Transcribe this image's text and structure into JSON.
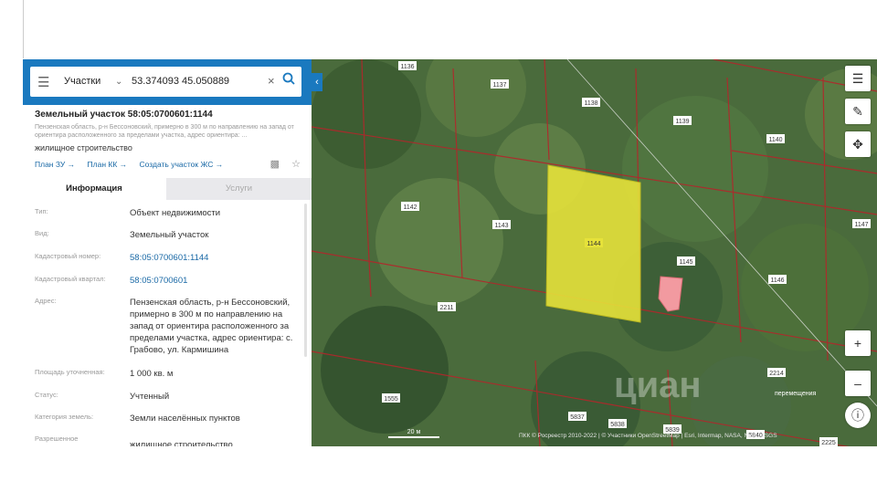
{
  "search": {
    "category": "Участки",
    "query": "53.374093 45.050889"
  },
  "parcel": {
    "title": "Земельный участок 58:05:0700601:1144",
    "subtitle": "Пензенская область, р-н Бессоновский, примерно в 300 м по направлению на запад от ориентира расположенного за пределами участка, адрес ориентира: ...",
    "use": "жилищное строительство",
    "links": [
      "План ЗУ →",
      "План КК →",
      "Создать участок ЖС →"
    ]
  },
  "tabs": [
    "Информация",
    "Услуги"
  ],
  "info": [
    {
      "label": "Тип:",
      "value": "Объект недвижимости"
    },
    {
      "label": "Вид:",
      "value": "Земельный участок"
    },
    {
      "label": "Кадастровый номер:",
      "value": "58:05:0700601:1144"
    },
    {
      "label": "Кадастровый квартал:",
      "value": "58:05:0700601"
    },
    {
      "label": "Адрес:",
      "value": "Пензенская область, р-н Бессоновский, примерно в 300 м по направлению на запад от ориентира расположенного за пределами участка, адрес ориентира: с. Грабово, ул. Кармишина"
    },
    {
      "label": "Площадь уточненная:",
      "value": "1 000 кв. м"
    },
    {
      "label": "Статус:",
      "value": "Учтенный"
    },
    {
      "label": "Категория земель:",
      "value": "Земли населённых пунктов"
    },
    {
      "label": "Разрешенное",
      "value": "жилищное строительство"
    }
  ],
  "map": {
    "labels": [
      "1136",
      "1137",
      "1138",
      "1139",
      "1140",
      "1142",
      "1143",
      "1144",
      "1145",
      "1146",
      "1147",
      "2211",
      "2214",
      "1555",
      "5837",
      "5838",
      "5839",
      "5840",
      "2225"
    ],
    "selected_color": "#e6e23a",
    "building_color": "#f29aa0",
    "scale": "20 м",
    "attribution": "ПКК © Росреестр 2010-2022 | © Участники OpenStreetMap | Esri, Intermap, NASA, NGA, USGS",
    "watermark": "циан",
    "broken_image_text": "перемещения"
  },
  "icons": {
    "menu": "menu-icon",
    "chevron": "chevron-down-icon",
    "clear": "close-icon",
    "search": "search-icon",
    "layers": "layers-icon",
    "ruler": "ruler-icon",
    "locate": "locate-icon",
    "zoom_in": "plus-icon",
    "zoom_out": "minus-icon",
    "info": "info-icon"
  }
}
